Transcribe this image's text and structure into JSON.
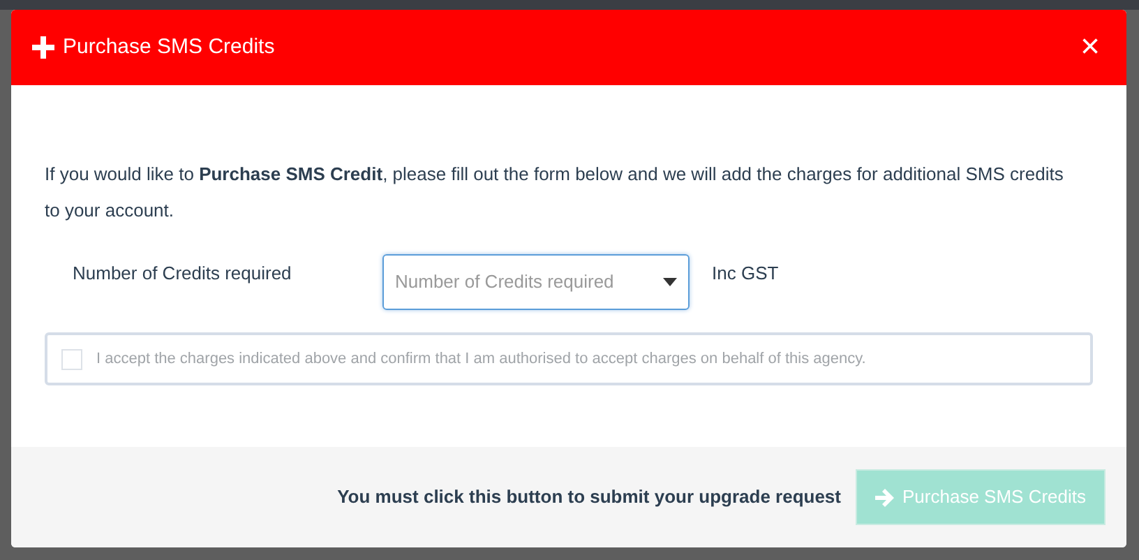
{
  "dialog": {
    "title": "Purchase SMS Credits",
    "close_symbol": "×"
  },
  "intro": "If you would like to **Purchase SMS Credit**, please fill out the form below and we will add the charges for additional SMS credits to your account.",
  "credits_field": {
    "label": "Number of Credits required",
    "placeholder": "Number of Credits required",
    "suffix": "Inc GST"
  },
  "accept": {
    "checked": false,
    "label": "I accept the charges indicated above and confirm that I am authorised to accept charges on behalf of this agency."
  },
  "footer": {
    "note": "You must click this button to submit your upgrade request",
    "button": {
      "label": "Purchase SMS Credits",
      "disabled": true
    }
  }
}
